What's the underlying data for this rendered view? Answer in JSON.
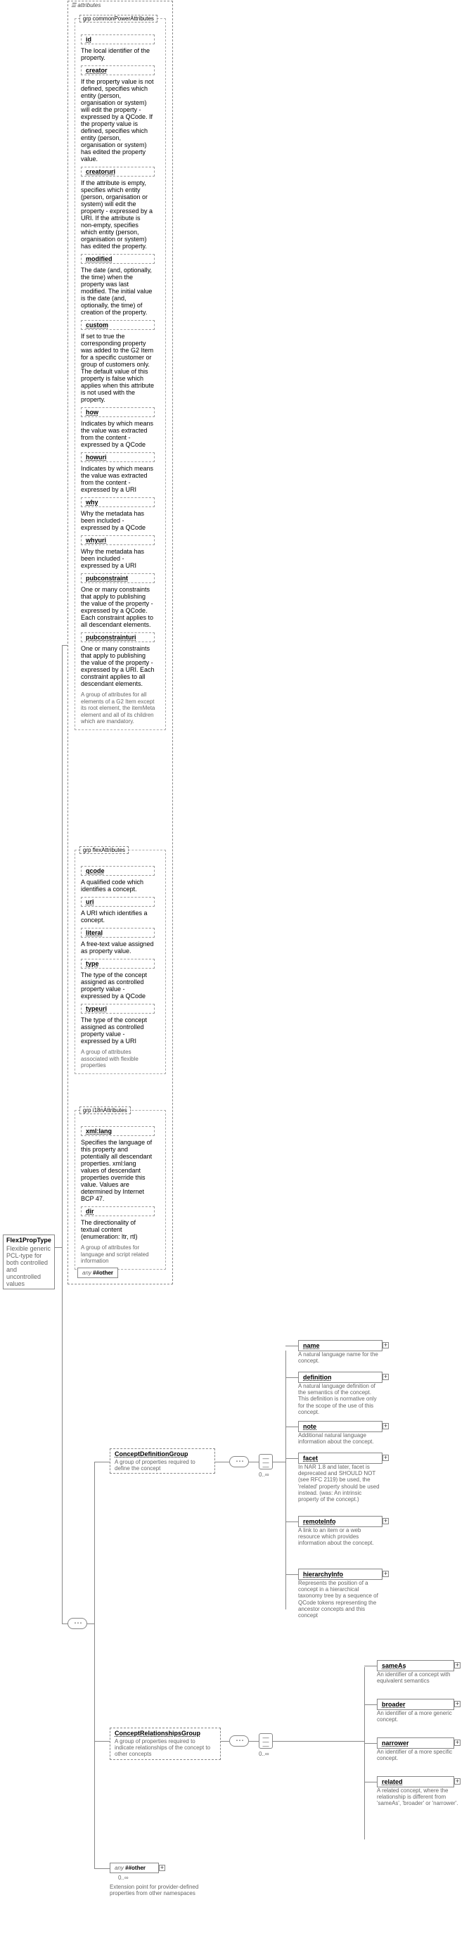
{
  "root": {
    "title": "Flex1PropType",
    "desc": "Flexible generic PCL-type for both controlled and uncontrolled values"
  },
  "attributes_box_label": "attributes",
  "groups": {
    "common": {
      "title": "grp  commonPowerAttributes",
      "desc": "A group of attributes for all elements of a G2 Item except its root element, the itemMeta element and all of its children which are mandatory.",
      "attrs": [
        {
          "name": "id",
          "desc": "The local identifier of the property."
        },
        {
          "name": "creator",
          "desc": "If the property value is not defined, specifies which entity (person, organisation or system) will edit the property - expressed by a QCode. If the property value is defined, specifies which entity (person, organisation or system) has edited the property value."
        },
        {
          "name": "creatoruri",
          "desc": "If the attribute is empty, specifies which entity (person, organisation or system) will edit the property - expressed by a URI. If the attribute is non-empty, specifies which entity (person, organisation or system) has edited the property."
        },
        {
          "name": "modified",
          "desc": "The date (and, optionally, the time) when the property was last modified. The initial value is the date (and, optionally, the time) of creation of the property."
        },
        {
          "name": "custom",
          "desc": "If set to true the corresponding property was added to the G2 Item for a specific customer or group of customers only. The default value of this property is false which applies when this attribute is not used with the property."
        },
        {
          "name": "how",
          "desc": "Indicates by which means the value was extracted from the content - expressed by a QCode"
        },
        {
          "name": "howuri",
          "desc": "Indicates by which means the value was extracted from the content - expressed by a URI"
        },
        {
          "name": "why",
          "desc": "Why the metadata has been included - expressed by a QCode"
        },
        {
          "name": "whyuri",
          "desc": "Why the metadata has been included - expressed by a URI"
        },
        {
          "name": "pubconstraint",
          "desc": "One or many constraints that apply to publishing the value of the property - expressed by a QCode. Each constraint applies to all descendant elements."
        },
        {
          "name": "pubconstrainturi",
          "desc": "One or many constraints that apply to publishing the value of the property - expressed by a URI. Each constraint applies to all descendant elements."
        }
      ]
    },
    "flex": {
      "title": "grp  flexAttributes",
      "desc": "A group of attributes associated with flexible properties",
      "attrs": [
        {
          "name": "qcode",
          "desc": "A qualified code which identifies a concept."
        },
        {
          "name": "uri",
          "desc": "A URI which identifies a concept."
        },
        {
          "name": "literal",
          "desc": "A free-text value assigned as property value."
        },
        {
          "name": "type",
          "desc": "The type of the concept assigned as controlled property value - expressed by a QCode"
        },
        {
          "name": "typeuri",
          "desc": "The type of the concept assigned as controlled property value - expressed by a URI"
        }
      ]
    },
    "i18n": {
      "title": "grp  i18nAttributes",
      "desc": "A group of attributes for language and script related information",
      "attrs": [
        {
          "name": "xml:lang",
          "desc": "Specifies the language of this property and potentially all descendant properties. xml:lang values of descendant properties override this value. Values are determined by Internet BCP 47."
        },
        {
          "name": "dir",
          "desc": "The directionality of textual content (enumeration: ltr, rtl)"
        }
      ]
    }
  },
  "any_other": {
    "label": "any",
    "val": "##other"
  },
  "cardinality_zero_inf": "0..∞",
  "definition_group": {
    "label": "ConceptDefinitionGroup",
    "desc": "A group of properties required to define the concept",
    "elements": [
      {
        "name": "name",
        "desc": "A natural language name for the concept."
      },
      {
        "name": "definition",
        "desc": "A natural language definition of the semantics of the concept. This definition is normative only for the scope of the use of this concept."
      },
      {
        "name": "note",
        "desc": "Additional natural language information about the concept."
      },
      {
        "name": "facet",
        "desc": "In NAR 1.8 and later, facet is deprecated and SHOULD NOT (see RFC 2119) be used, the 'related' property should be used instead. (was: An intrinsic property of the concept.)"
      },
      {
        "name": "remoteInfo",
        "desc": "A link to an item or a web resource which provides information about the concept."
      },
      {
        "name": "hierarchyInfo",
        "desc": "Represents the position of a concept in a hierarchical taxonomy tree by a sequence of QCode tokens representing the ancestor concepts and this concept"
      }
    ]
  },
  "relationships_group": {
    "label": "ConceptRelationshipsGroup",
    "desc": "A group of properties required to indicate relationships of the concept to other concepts",
    "elements": [
      {
        "name": "sameAs",
        "desc": "An identifier of a concept with equivalent semantics"
      },
      {
        "name": "broader",
        "desc": "An identifier of a more generic concept."
      },
      {
        "name": "narrower",
        "desc": "An identifier of a more specific concept."
      },
      {
        "name": "related",
        "desc": "A related concept, where the relationship is different from 'sameAs', 'broader' or 'narrower'."
      }
    ]
  },
  "ext_any": {
    "label": "any",
    "val": "##other",
    "desc": "Extension point for provider-defined properties from other namespaces"
  }
}
